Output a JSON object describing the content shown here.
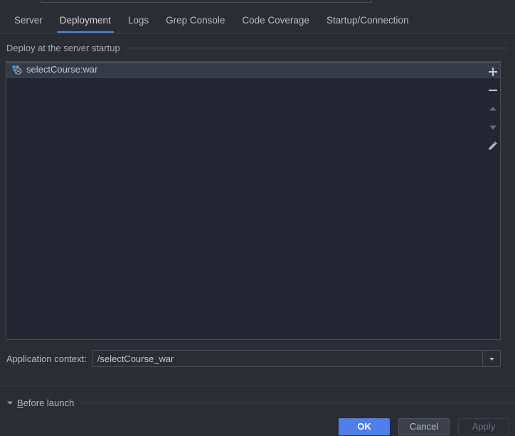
{
  "window": {
    "tabs": [
      {
        "label": "Server",
        "selected": false
      },
      {
        "label": "Deployment",
        "selected": true
      },
      {
        "label": "Logs",
        "selected": false
      },
      {
        "label": "Grep Console",
        "selected": false
      },
      {
        "label": "Code Coverage",
        "selected": false
      },
      {
        "label": "Startup/Connection",
        "selected": false
      }
    ]
  },
  "deploy_section": {
    "title": "Deploy at the server startup",
    "items": [
      {
        "label": "selectCourse:war",
        "icon": "artifact-war-icon",
        "selected": true
      }
    ],
    "toolbar": [
      {
        "name": "add-button",
        "icon": "plus-icon",
        "enabled": true
      },
      {
        "name": "remove-button",
        "icon": "minus-icon",
        "enabled": true
      },
      {
        "name": "move-up-button",
        "icon": "arrow-up-icon",
        "enabled": false
      },
      {
        "name": "move-down-button",
        "icon": "arrow-down-icon",
        "enabled": false
      },
      {
        "name": "edit-button",
        "icon": "pencil-icon",
        "enabled": true
      }
    ]
  },
  "application_context": {
    "label": "Application context:",
    "value": "/selectCourse_war",
    "placeholder": ""
  },
  "before_launch": {
    "mnemonic": "B",
    "label_rest": "efore launch",
    "expanded": true
  },
  "buttons": {
    "ok": "OK",
    "cancel": "Cancel",
    "apply": "Apply"
  },
  "colors": {
    "accent_blue": "#4f7fe8",
    "tab_underline": "#4c84e8",
    "panel_bg": "#232630",
    "window_bg": "#2b2d34",
    "selected_row_bg": "#343a46",
    "border": "#4a4e58",
    "text": "#bcbfc7",
    "disabled_text": "#6a6e78"
  }
}
